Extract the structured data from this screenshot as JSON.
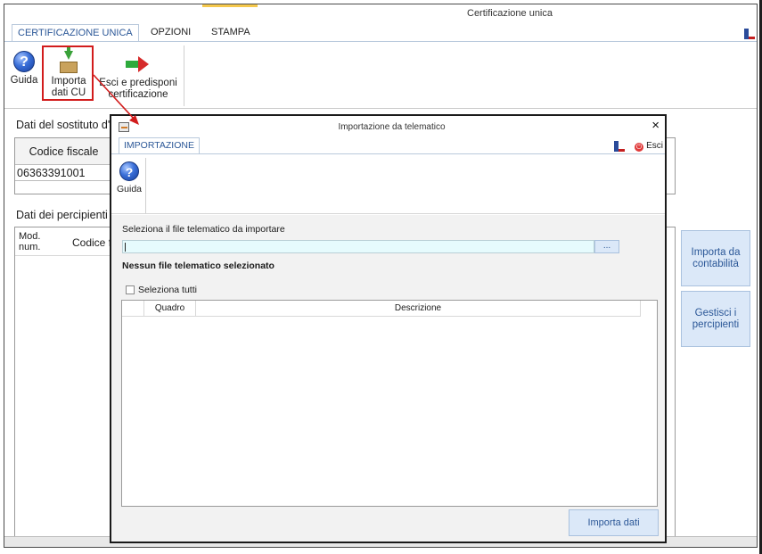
{
  "main": {
    "title": "Certificazione unica",
    "tabs": [
      "CERTIFICAZIONE UNICA",
      "OPZIONI",
      "STAMPA"
    ],
    "ribbon": {
      "guida": "Guida",
      "importa_line1": "Importa",
      "importa_line2": "dati CU",
      "esci_line1": "Esci e predisponi",
      "esci_line2": "certificazione"
    },
    "sostituto_label": "Dati del sostituto d'",
    "codice_fiscale_header": "Codice fiscale",
    "codice_fiscale_value": "06363391001",
    "percipienti_label": "Dati dei percipienti",
    "mod_num_header": "Mod. num.",
    "codice_header": "Codice f",
    "side_buttons": {
      "importa_contabilita_1": "Importa da",
      "importa_contabilita_2": "contabilità",
      "gestisci_1": "Gestisci i",
      "gestisci_2": "percipienti"
    }
  },
  "dialog": {
    "title": "Importazione da telematico",
    "close_glyph": "×",
    "tab": "IMPORTAZIONE",
    "esci": "Esci",
    "guida": "Guida",
    "file_label": "Seleziona il file telematico da importare",
    "file_value": "",
    "browse_label": "...",
    "no_file_text": "Nessun file telematico selezionato",
    "select_all_label": "Seleziona tutti",
    "select_all_checked": false,
    "table_headers": [
      "Quadro",
      "Descrizione"
    ],
    "import_button": "Importa dati"
  },
  "colors": {
    "accent_blue": "#2b5797",
    "highlight_red": "#d21c1c",
    "button_fill": "#dbe8f8",
    "input_fill": "#e6fbfd"
  },
  "icons": [
    "help-icon",
    "import-icon",
    "exit-arrow-icon",
    "flag-icon",
    "close-icon",
    "esci-icon",
    "dialog-app-icon"
  ]
}
